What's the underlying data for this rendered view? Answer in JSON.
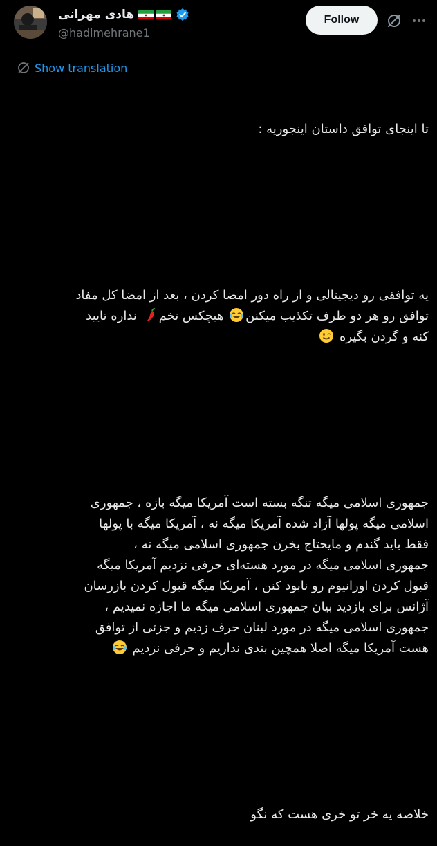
{
  "author": {
    "display_name": "هادی مهرانی",
    "handle": "@hadimehrane1",
    "verified": true,
    "flags": [
      "iran-flag",
      "iran-flag"
    ]
  },
  "header": {
    "follow_label": "Follow",
    "grok_icon": "grok-icon",
    "more_icon": "more-horizontal-icon"
  },
  "translate": {
    "label": "Show translation",
    "icon": "translate-globe-icon"
  },
  "post": {
    "lines_p1": [
      "تا اینجای توافق داستان اینجوریه :"
    ],
    "lines_p2": [
      "یه توافقی رو دیجیتالی و از راه دور امضا کردن ، بعد از امضا کل مفاد",
      "توافق رو هر دو طرف تکذیب میکنن",
      " هیچکس تخم",
      " نداره تایید",
      "کنه و گردن بگیره"
    ],
    "lines_p3": [
      "جمهوری اسلامی میگه تنگه بسته است آمریکا میگه بازه ، جمهوری",
      "اسلامی میگه پولها آزاد شده آمریکا میگه نه ، آمریکا میگه با پولها",
      "فقط باید گندم و مایحتاج بخرن جمهوری اسلامی میگه نه ،",
      "جمهوری اسلامی میگه در مورد هسته‌ای حرفی نزدیم آمریکا میگه",
      "قبول کردن اورانیوم رو نابود کنن ، آمریکا میگه قبول کردن بازرسان",
      "آژانس برای بازدید بیان جمهوری اسلامی میگه ما اجازه نمیدیم ،",
      "جمهوری اسلامی میگه در مورد لبنان حرف زدیم و جزئی از توافق",
      "هست آمریکا میگه اصلا همچین بندی نداریم و حرفی نزدیم"
    ],
    "lines_p4": [
      "خلاصه یه خر تو خری هست که نگو"
    ],
    "emojis": [
      "tears-of-joy-emoji",
      "chili-pepper-emoji",
      "winking-face-emoji",
      "tears-of-joy-emoji"
    ]
  },
  "colors": {
    "background": "#000000",
    "text": "#e7e9ea",
    "muted": "#71767b",
    "link": "#1d9bf0",
    "follow_bg": "#eff3f4"
  }
}
